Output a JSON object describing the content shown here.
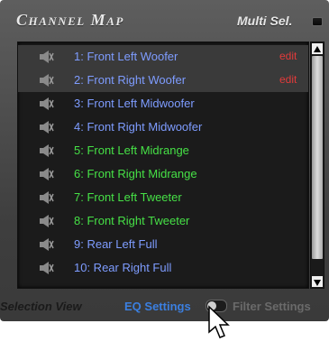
{
  "header": {
    "title": "Channel Map",
    "multi_sel_label": "Multi Sel."
  },
  "list": {
    "items": [
      {
        "label": "1: Front Left Woofer",
        "color": "#7e9cff",
        "selected": true,
        "edit": "edit"
      },
      {
        "label": "2: Front Right Woofer",
        "color": "#7e9cff",
        "selected": true,
        "edit": "edit"
      },
      {
        "label": "3: Front Left Midwoofer",
        "color": "#7e9cff",
        "selected": false
      },
      {
        "label": "4: Front Right Midwoofer",
        "color": "#7e9cff",
        "selected": false
      },
      {
        "label": "5: Front Left Midrange",
        "color": "#46e146",
        "selected": false
      },
      {
        "label": "6: Front Right Midrange",
        "color": "#46e146",
        "selected": false
      },
      {
        "label": "7: Front Left Tweeter",
        "color": "#46e146",
        "selected": false
      },
      {
        "label": "8: Front Right Tweeter",
        "color": "#46e146",
        "selected": false
      },
      {
        "label": "9: Rear Left Full",
        "color": "#7e9cff",
        "selected": false
      },
      {
        "label": "10: Rear Right Full",
        "color": "#7e9cff",
        "selected": false
      }
    ]
  },
  "footer": {
    "selection_view_label": "Selection View",
    "eq_settings_label": "EQ Settings",
    "filter_settings_label": "Filter Settings"
  },
  "icons": {
    "speaker": "speaker-icon",
    "cursor": "mouse-cursor-icon"
  },
  "colors": {
    "accent_blue": "#3b7fe0",
    "edit_red": "#e23a3a",
    "selected_text": "#7e9cff",
    "green_text": "#46e146"
  }
}
